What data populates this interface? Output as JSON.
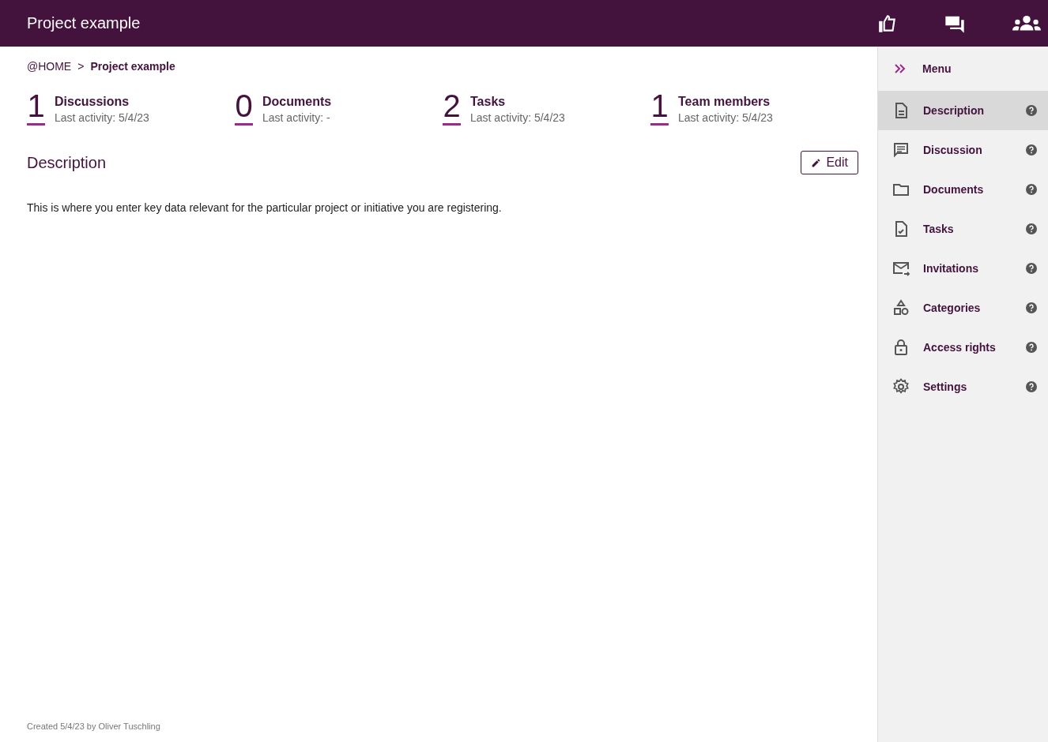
{
  "header": {
    "title": "Project example"
  },
  "breadcrumb": [
    {
      "label": "@HOME",
      "current": false
    },
    {
      "label": "Project example",
      "current": true
    }
  ],
  "breadcrumb_separator": ">",
  "stats": [
    {
      "count": "1",
      "label": "Discussions",
      "activity": "Last activity: 5/4/23"
    },
    {
      "count": "0",
      "label": "Documents",
      "activity": "Last activity: -"
    },
    {
      "count": "2",
      "label": "Tasks",
      "activity": "Last activity: 5/4/23"
    },
    {
      "count": "1",
      "label": "Team members",
      "activity": "Last activity: 5/4/23"
    }
  ],
  "section": {
    "title": "Description",
    "edit_button": "Edit",
    "body": "This is where you enter key data relevant for the particular project or initiative you are registering."
  },
  "footer": "Created 5/4/23 by Oliver Tuschling",
  "sidebar": {
    "menu_label": "Menu",
    "items": [
      {
        "label": "Description",
        "selected": true
      },
      {
        "label": "Discussion",
        "selected": false
      },
      {
        "label": "Documents",
        "selected": false
      },
      {
        "label": "Tasks",
        "selected": false
      },
      {
        "label": "Invitations",
        "selected": false
      },
      {
        "label": "Categories",
        "selected": false
      },
      {
        "label": "Access rights",
        "selected": false
      },
      {
        "label": "Settings",
        "selected": false
      }
    ]
  }
}
